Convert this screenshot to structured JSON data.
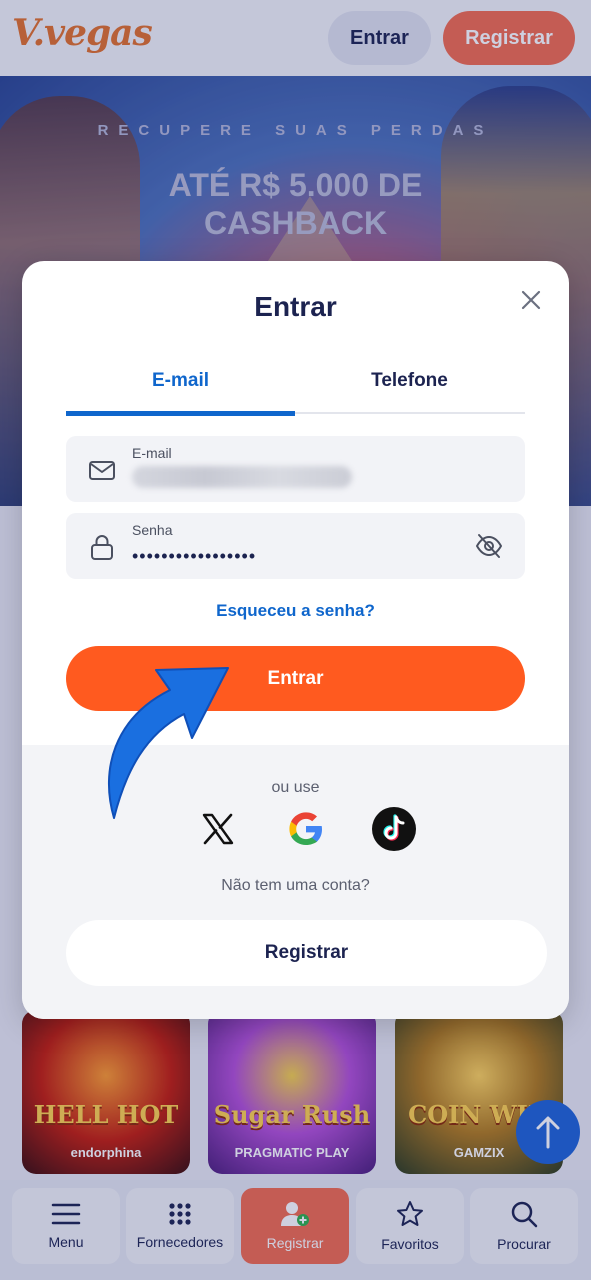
{
  "header": {
    "logo_text": "V.vegas",
    "login_label": "Entrar",
    "register_label": "Registrar"
  },
  "banner": {
    "subtitle": "RECUPERE SUAS PERDAS",
    "title": "ATÉ R$ 5.000 DE CASHBACK"
  },
  "games": [
    {
      "name": "HELL HOT",
      "provider": "endorphina"
    },
    {
      "name": "Sugar Rush",
      "provider": "PRAGMATIC PLAY"
    },
    {
      "name": "COIN WIN",
      "provider": "GAMZIX"
    }
  ],
  "bottom_nav": [
    {
      "label": "Menu",
      "icon": "menu-icon"
    },
    {
      "label": "Fornecedores",
      "icon": "grid-icon"
    },
    {
      "label": "Registrar",
      "icon": "add-user-icon"
    },
    {
      "label": "Favoritos",
      "icon": "star-icon"
    },
    {
      "label": "Procurar",
      "icon": "search-icon"
    }
  ],
  "modal": {
    "title": "Entrar",
    "tabs": [
      {
        "label": "E-mail",
        "active": true
      },
      {
        "label": "Telefone",
        "active": false
      }
    ],
    "email_label": "E-mail",
    "password_label": "Senha",
    "password_value": "•••••••••••••••••",
    "forgot_label": "Esqueceu a senha?",
    "submit_label": "Entrar",
    "or_use": "ou use",
    "social": [
      "x-icon",
      "google-icon",
      "tiktok-icon"
    ],
    "no_account": "Não tem uma conta?",
    "register_label": "Registrar"
  },
  "colors": {
    "primary_orange": "#ff5a1f",
    "tab_blue": "#0f66cc",
    "navy_text": "#1c2350",
    "header_register": "#f26b4e"
  }
}
